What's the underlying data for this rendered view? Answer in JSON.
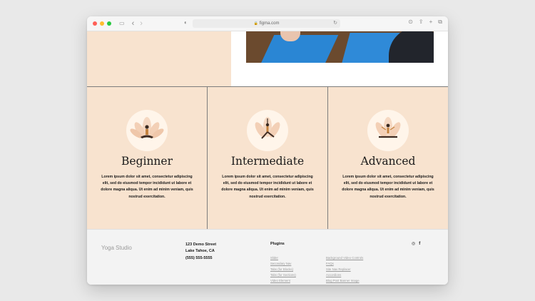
{
  "browser": {
    "url": "figma.com",
    "traffic_colors": [
      "#ff5f57",
      "#febc2e",
      "#28c840"
    ],
    "icons": {
      "sidebar": "▭",
      "back": "‹",
      "forward": "›",
      "privacy": "◐",
      "lock": "🔒",
      "reload": "↻",
      "download": "⊙",
      "share": "⇪",
      "new_tab": "+",
      "tabs": "⧉"
    }
  },
  "levels": [
    {
      "title": "Beginner",
      "text": "Lorem ipsum dolor sit amet, consectetur adipiscing elit, sed do eiusmod tempor incididunt ut labore et dolore magna aliqua. Ut enim ad minim veniam, quis nostrud exercitation."
    },
    {
      "title": "Intermediate",
      "text": "Lorem ipsum dolor sit amet, consectetur adipiscing elit, sed do eiusmod tempor incididunt ut labore et dolore magna aliqua. Ut enim ad minim veniam, quis nostrud exercitation."
    },
    {
      "title": "Advanced",
      "text": "Lorem ipsum dolor sit amet, consectetur adipiscing elit, sed do eiusmod tempor incididunt ut labore et dolore magna aliqua. Ut enim ad minim veniam, quis nostrud exercitation."
    }
  ],
  "footer": {
    "brand": "Yoga Studio",
    "address": {
      "line1": "123 Demo Street",
      "line2": "Lake Tahoe, CA",
      "phone": "(555) 555-5555"
    },
    "plugins_title": "Plugins",
    "plugins_col1": [
      "Slider",
      "Secondary Nav",
      "Tabs (for Blocks)",
      "Tabs (for Sections)",
      "Video Element"
    ],
    "plugins_col2": [
      "Background Video Controls",
      "FAQs",
      "Site Nav Replacer",
      "Accordions",
      "Blog Post Banner Image"
    ],
    "social": {
      "instagram": "◎",
      "facebook": "f"
    }
  }
}
